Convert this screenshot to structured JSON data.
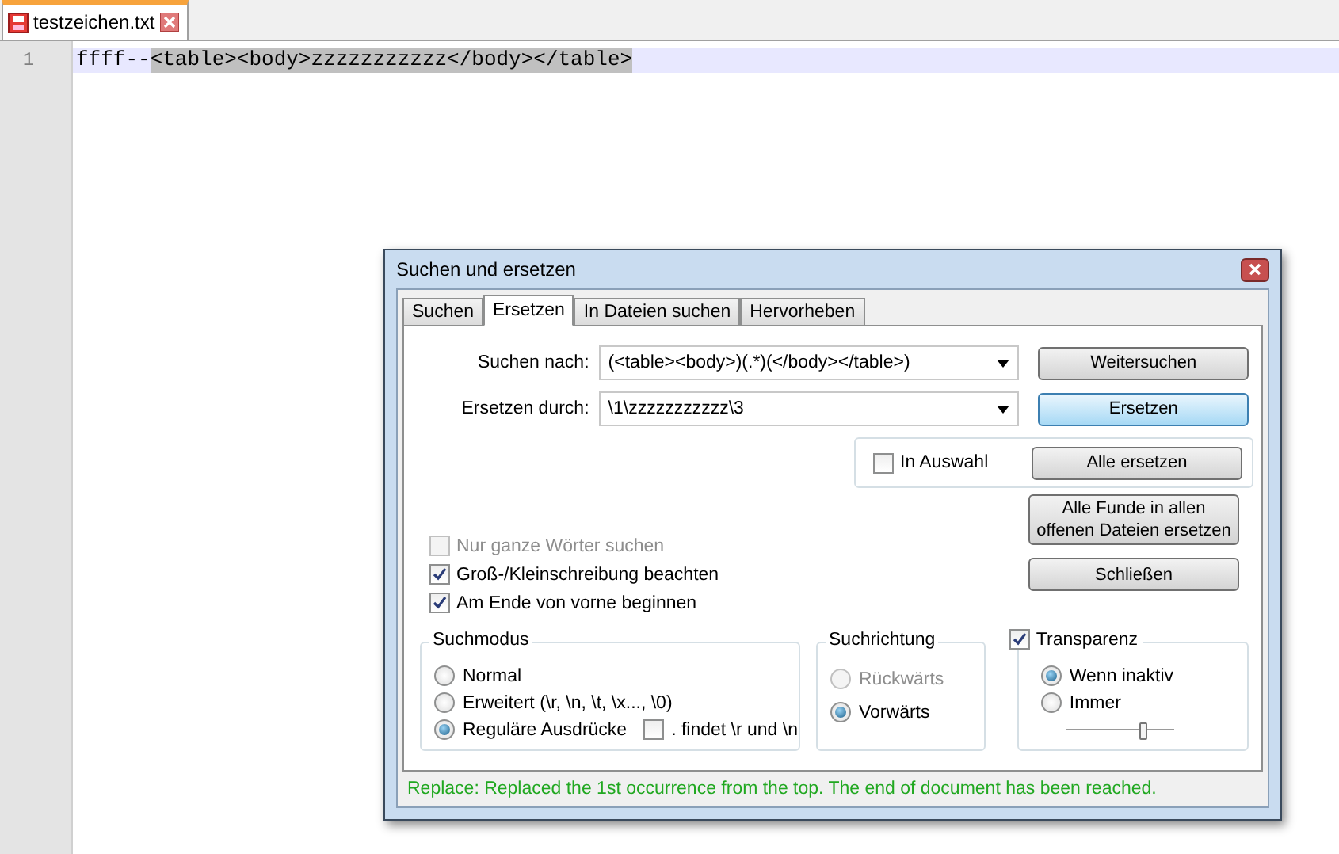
{
  "editor": {
    "tab": {
      "label": "testzeichen.txt"
    },
    "lines": [
      {
        "number": "1",
        "plain": "ffff--",
        "selected": "<table><body>zzzzzzzzzzz</body></table>"
      }
    ]
  },
  "dialog": {
    "title": "Suchen und ersetzen",
    "tabs": [
      {
        "label": "Suchen",
        "selected": false
      },
      {
        "label": "Ersetzen",
        "selected": true
      },
      {
        "label": "In Dateien suchen",
        "selected": false
      },
      {
        "label": "Hervorheben",
        "selected": false
      }
    ],
    "fields": [
      {
        "label": "Suchen nach:",
        "value": "(<table><body>)(.*)(</body></table>)"
      },
      {
        "label": "Ersetzen durch:",
        "value": "\\1\\zzzzzzzzzzz\\3"
      }
    ],
    "buttons": [
      {
        "label": "Weitersuchen",
        "highlighted": false
      },
      {
        "label": "Ersetzen",
        "highlighted": true
      },
      {
        "label": "Alle ersetzen",
        "highlighted": false
      },
      {
        "label": "Alle Funde in allen offenen Dateien ersetzen",
        "highlighted": false
      },
      {
        "label": "Schließen",
        "highlighted": false
      }
    ],
    "in_selection": {
      "label": "In Auswahl",
      "checked": false
    },
    "options": [
      {
        "label": "Nur ganze Wörter suchen",
        "checked": false,
        "disabled": true
      },
      {
        "label": "Groß-/Kleinschreibung beachten",
        "checked": true,
        "disabled": false
      },
      {
        "label": "Am Ende von vorne beginnen",
        "checked": true,
        "disabled": false
      }
    ],
    "search_mode": {
      "title": "Suchmodus",
      "options": [
        {
          "label": "Normal",
          "selected": false
        },
        {
          "label": "Erweitert (\\r, \\n, \\t, \\x..., \\0)",
          "selected": false
        },
        {
          "label": "Reguläre Ausdrücke",
          "selected": true
        }
      ],
      "dot_newline": {
        "label": ". findet \\r und \\n",
        "checked": false
      }
    },
    "direction": {
      "title": "Suchrichtung",
      "options": [
        {
          "label": "Rückwärts",
          "selected": false,
          "disabled": true
        },
        {
          "label": "Vorwärts",
          "selected": true,
          "disabled": false
        }
      ]
    },
    "transparency": {
      "label": "Transparenz",
      "checked": true,
      "options": [
        {
          "label": "Wenn inaktiv",
          "selected": true
        },
        {
          "label": "Immer",
          "selected": false
        }
      ],
      "level": 0.72
    },
    "status": "Replace: Replaced the 1st occurrence from the top. The end of document has been reached."
  }
}
